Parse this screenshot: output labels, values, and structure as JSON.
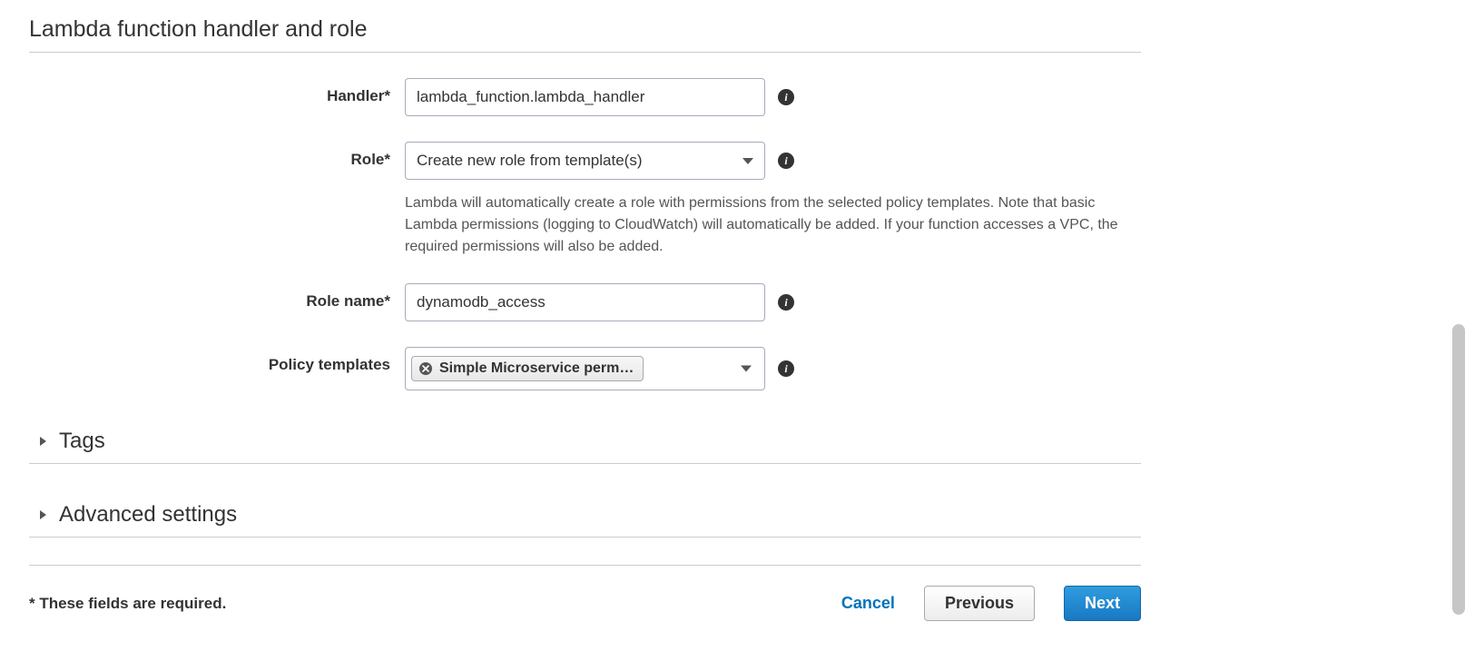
{
  "section": {
    "title": "Lambda function handler and role"
  },
  "handler": {
    "label": "Handler*",
    "value": "lambda_function.lambda_handler"
  },
  "role": {
    "label": "Role*",
    "selected": "Create new role from template(s)",
    "help": "Lambda will automatically create a role with permissions from the selected policy templates. Note that basic Lambda permissions (logging to CloudWatch) will automatically be added. If your function accesses a VPC, the required permissions will also be added."
  },
  "roleName": {
    "label": "Role name*",
    "value": "dynamodb_access"
  },
  "policyTemplates": {
    "label": "Policy templates",
    "tag": "Simple Microservice perm…"
  },
  "collapsible": {
    "tags": "Tags",
    "advanced": "Advanced settings"
  },
  "footer": {
    "required_note": "* These fields are required.",
    "cancel": "Cancel",
    "previous": "Previous",
    "next": "Next"
  }
}
